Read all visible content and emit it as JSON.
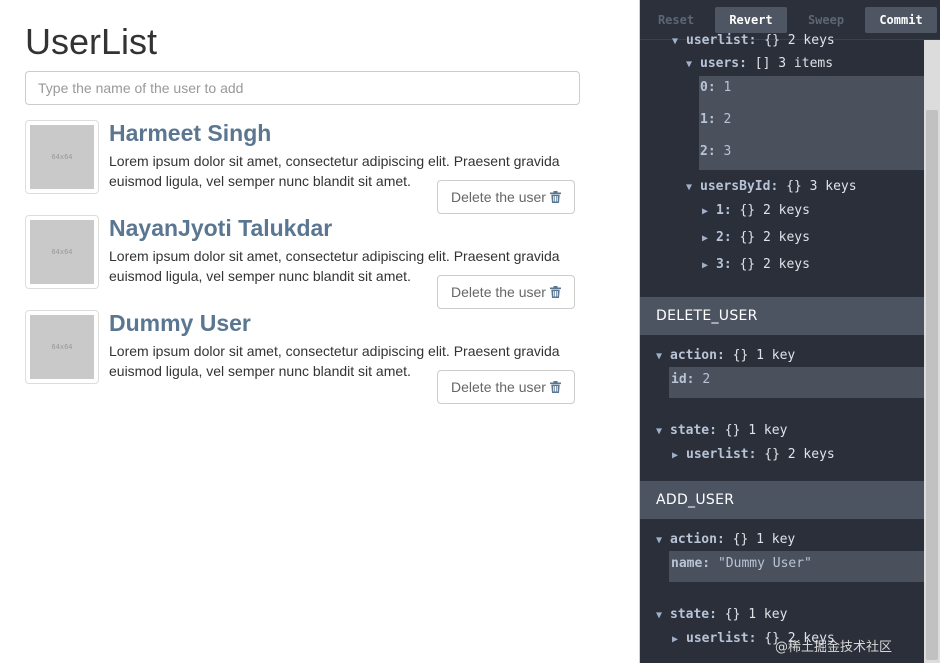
{
  "app": {
    "title": "UserList",
    "add_placeholder": "Type the name of the user to add",
    "avatar_placeholder": "64x64",
    "users": [
      {
        "name": "Harmeet Singh",
        "desc": "Lorem ipsum dolor sit amet, consectetur adipiscing elit. Praesent gravida euismod ligula, vel semper nunc blandit sit amet.",
        "delete_label": "Delete the user"
      },
      {
        "name": "NayanJyoti Talukdar",
        "desc": "Lorem ipsum dolor sit amet, consectetur adipiscing elit. Praesent gravida euismod ligula, vel semper nunc blandit sit amet.",
        "delete_label": "Delete the user"
      },
      {
        "name": "Dummy User",
        "desc": "Lorem ipsum dolor sit amet, consectetur adipiscing elit. Praesent gravida euismod ligula, vel semper nunc blandit sit amet.",
        "delete_label": "Delete the user"
      }
    ]
  },
  "devtools": {
    "toolbar": {
      "reset": "Reset",
      "revert": "Revert",
      "sweep": "Sweep",
      "commit": "Commit"
    },
    "tree_top": {
      "userlist_key": "userlist:",
      "userlist_val": "{} 2 keys",
      "users_key": "users:",
      "users_val": "[] 3 items",
      "items": [
        {
          "k": "0:",
          "v": "1"
        },
        {
          "k": "1:",
          "v": "2"
        },
        {
          "k": "2:",
          "v": "3"
        }
      ],
      "usersbyid_key": "usersById:",
      "usersbyid_val": "{} 3 keys",
      "byid": [
        {
          "k": "1:",
          "v": "{} 2 keys"
        },
        {
          "k": "2:",
          "v": "{} 2 keys"
        },
        {
          "k": "3:",
          "v": "{} 2 keys"
        }
      ]
    },
    "delete_section": {
      "title": "DELETE_USER",
      "action_key": "action:",
      "action_val": "{} 1 key",
      "id_key": "id:",
      "id_val": "2",
      "state_key": "state:",
      "state_val": "{} 1 key",
      "userlist_key": "userlist:",
      "userlist_val": "{} 2 keys"
    },
    "add_section": {
      "title": "ADD_USER",
      "action_key": "action:",
      "action_val": "{} 1 key",
      "name_key": "name:",
      "name_val": "\"Dummy User\"",
      "state_key": "state:",
      "state_val": "{} 1 key",
      "userlist_key": "userlist:",
      "userlist_val": "{} 2 keys"
    },
    "watermark": "@稀土掘金技术社区"
  }
}
